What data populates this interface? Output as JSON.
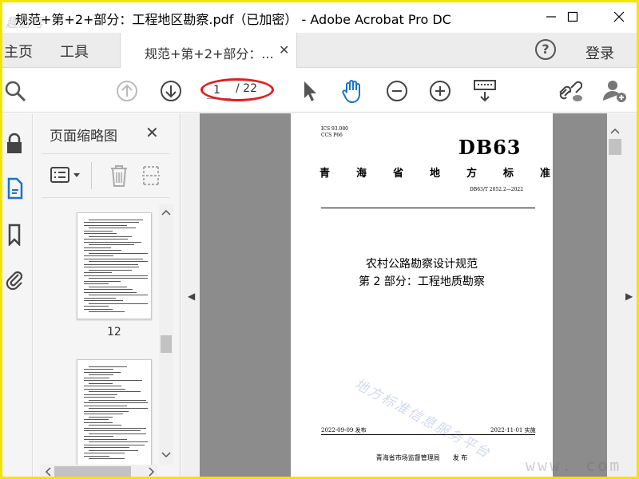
{
  "window": {
    "title": "规范+第+2+部分：工程地区勘察.pdf（已加密） - Adobe Acrobat Pro DC",
    "watermark_logo": "趣游号"
  },
  "tabs": {
    "home": "主页",
    "tools": "工具",
    "document": "规范+第+2+部分：...",
    "login": "登录",
    "help": "?"
  },
  "toolbar": {
    "page_current": "1",
    "page_total": "/ 22",
    "icons": [
      "search-icon",
      "page-up-icon",
      "page-down-icon",
      "select-cursor-icon",
      "hand-tool-icon",
      "zoom-out-icon",
      "zoom-in-icon",
      "keyboard-scroll-icon",
      "share-link-icon",
      "add-user-icon"
    ]
  },
  "thumbnail_panel": {
    "title": "页面缩略图",
    "close": "✕",
    "page_labels": [
      "12"
    ]
  },
  "document_page": {
    "ics": "ICS 93.080",
    "ccs": "CCS P66",
    "logo": "DB63",
    "standard_title": "青海省地方标准",
    "code": "DB63/T 2052.2—2022",
    "title_line1": "农村公路勘察设计规范",
    "title_line2": "第 2 部分：工程地质勘察",
    "publish_date": "2022-09-09 发布",
    "implement_date": "2022-11-01 实施",
    "issuer": "青海省市场监督管理局　　发 布",
    "watermark": "地方标准信息服务平台"
  },
  "overlay": {
    "corner_watermark": "www.      com",
    "annotation_color": "#e02020",
    "frame_color": "#f2e600"
  }
}
